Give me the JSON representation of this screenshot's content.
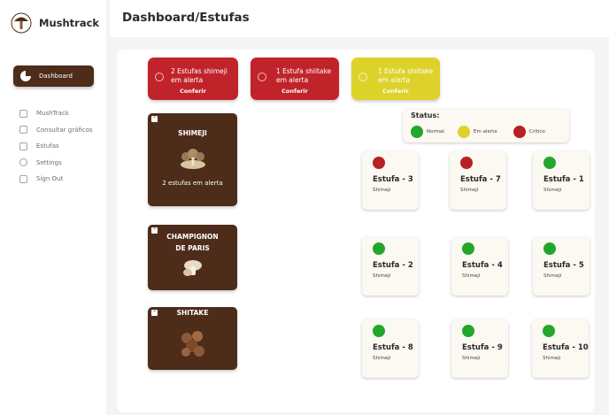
{
  "app": {
    "name": "Mushtrack"
  },
  "sidebar": {
    "active": {
      "label": "Dashboard",
      "icon": "pie-chart-icon"
    },
    "items": [
      {
        "label": "MushTrack",
        "icon": "list-icon"
      },
      {
        "label": "Consultar gráficos",
        "icon": "bar-chart-icon"
      },
      {
        "label": "Estufas",
        "icon": "folder-icon"
      },
      {
        "label": "Settings",
        "icon": "gear-icon"
      },
      {
        "label": "Sign Out",
        "icon": "sign-out-icon"
      }
    ]
  },
  "header": {
    "title": "Dashboard/Estufas"
  },
  "alerts": [
    {
      "text": "2 Estufas shimeji em alerta",
      "button": "Conferir",
      "color": "#c0242a"
    },
    {
      "text": "1 Estufa shiitake em alerta",
      "button": "Conferir",
      "color": "#c0242a"
    },
    {
      "text": "1 Estufa shiitake em alerta",
      "button": "Conferir",
      "color": "#ddd22a"
    }
  ],
  "types": [
    {
      "title": "SHIMEJI",
      "subtitle": "2 estufas em alerta"
    },
    {
      "title": "CHAMPIGNON DE PARIS",
      "subtitle": ""
    },
    {
      "title": "SHITAKE",
      "subtitle": ""
    }
  ],
  "status_legend": {
    "title": "Status:",
    "items": [
      {
        "label": "Normal",
        "color": "#22a72a"
      },
      {
        "label": "Em alerta",
        "color": "#e0cf2c"
      },
      {
        "label": "Crítico",
        "color": "#b62126"
      }
    ]
  },
  "estufas": [
    {
      "name": "Estufa - 3",
      "type": "Shimeji",
      "status": "Crítico",
      "color": "#b62126"
    },
    {
      "name": "Estufa - 7",
      "type": "Shimeji",
      "status": "Crítico",
      "color": "#b62126"
    },
    {
      "name": "Estufa - 1",
      "type": "Shimeji",
      "status": "Normal",
      "color": "#22a72a"
    },
    {
      "name": "Estufa - 2",
      "type": "Shimeji",
      "status": "Normal",
      "color": "#22a72a"
    },
    {
      "name": "Estufa - 4",
      "type": "Shimeji",
      "status": "Normal",
      "color": "#22a72a"
    },
    {
      "name": "Estufa - 5",
      "type": "Shimeji",
      "status": "Normal",
      "color": "#22a72a"
    },
    {
      "name": "Estufa - 8",
      "type": "Shimeji",
      "status": "Normal",
      "color": "#22a72a"
    },
    {
      "name": "Estufa - 9",
      "type": "Shimeji",
      "status": "Normal",
      "color": "#22a72a"
    },
    {
      "name": "Estufa - 10",
      "type": "Shimeji",
      "status": "Normal",
      "color": "#22a72a"
    }
  ]
}
